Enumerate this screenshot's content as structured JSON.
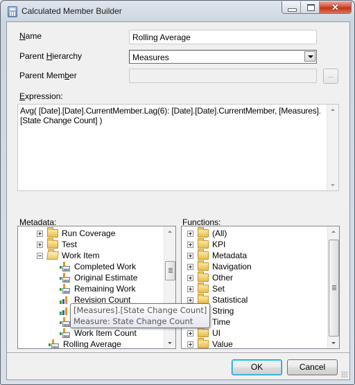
{
  "window": {
    "title": "Calculated Member Builder",
    "caption_buttons": {
      "minimize": "minimize",
      "maximize": "maximize",
      "close": "✕"
    }
  },
  "form": {
    "name_label_accel": "N",
    "name_label_rest": "ame",
    "name_value": "Rolling Average",
    "parent_hierarchy_label_pre": "Parent ",
    "parent_hierarchy_label_accel": "H",
    "parent_hierarchy_label_rest": "ierarchy",
    "parent_hierarchy_value": "Measures",
    "parent_member_label_pre": "Parent Mem",
    "parent_member_label_accel": "b",
    "parent_member_label_rest": "er",
    "parent_member_value": "",
    "ellipsis_button": "...",
    "expression_label_accel": "E",
    "expression_label_rest": "xpression:",
    "expression_value": "Avg(  [Date].[Date].CurrentMember.Lag(6): [Date].[Date].CurrentMember, [Measures].[State Change Count]  )"
  },
  "metadata": {
    "label_accel": "M",
    "label_rest": "etadata:",
    "items": [
      {
        "label": "Run Coverage",
        "type": "folder",
        "expander": "plus",
        "level": 1
      },
      {
        "label": "Test",
        "type": "folder",
        "expander": "plus",
        "level": 1
      },
      {
        "label": "Work Item",
        "type": "folder-open",
        "expander": "minus",
        "level": 1
      },
      {
        "label": "Completed Work",
        "type": "calculated-measure",
        "level": 2
      },
      {
        "label": "Original Estimate",
        "type": "calculated-measure",
        "level": 2
      },
      {
        "label": "Remaining Work",
        "type": "calculated-measure",
        "level": 2
      },
      {
        "label": "Revision Count",
        "type": "measure",
        "level": 2
      },
      {
        "label": "State Change Count",
        "type": "measure",
        "level": 2
      },
      {
        "label": "",
        "type": "calculated-measure",
        "level": 2
      },
      {
        "label": "Work Item Count",
        "type": "calculated-measure",
        "level": 2
      },
      {
        "label": "Rolling Average",
        "type": "calculated-measure",
        "level": 0
      }
    ],
    "tooltip": {
      "line1": "[Measures].[State Change Count]",
      "line2": "Measure: State Change Count"
    },
    "scroll_position": 0.45
  },
  "functions": {
    "label_accel": "F",
    "label_rest": "unctions:",
    "items": [
      {
        "label": "(All)"
      },
      {
        "label": "KPI"
      },
      {
        "label": "Metadata"
      },
      {
        "label": "Navigation"
      },
      {
        "label": "Other"
      },
      {
        "label": "Set"
      },
      {
        "label": "Statistical"
      },
      {
        "label": "String"
      },
      {
        "label": "Time"
      },
      {
        "label": "UI"
      },
      {
        "label": "Value"
      }
    ]
  },
  "buttons": {
    "ok": "OK",
    "cancel": "Cancel"
  }
}
